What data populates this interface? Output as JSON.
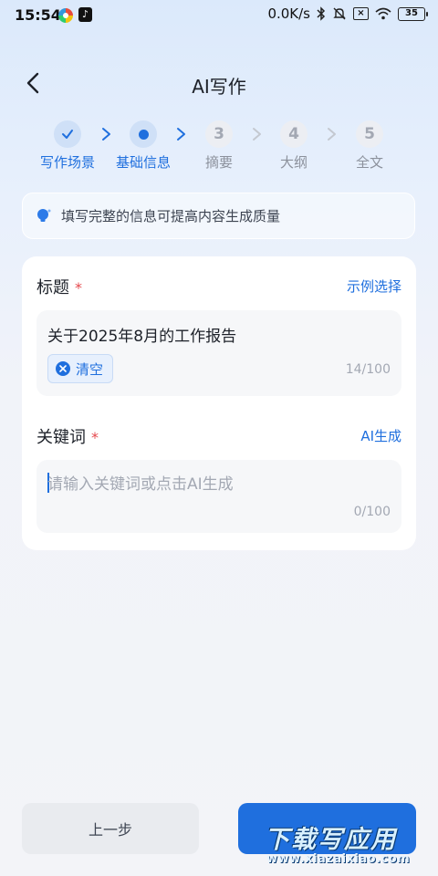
{
  "status_bar": {
    "time": "15:54",
    "net_speed": "0.0K/s",
    "battery": "35",
    "app_icon_2": "♪"
  },
  "header": {
    "title": "AI写作",
    "back_icon": "chevron-left-icon"
  },
  "steps": [
    {
      "number": "✓",
      "label": "写作场景",
      "state": "done"
    },
    {
      "number": "●",
      "label": "基础信息",
      "state": "active"
    },
    {
      "number": "3",
      "label": "摘要",
      "state": "pending"
    },
    {
      "number": "4",
      "label": "大纲",
      "state": "pending"
    },
    {
      "number": "5",
      "label": "全文",
      "state": "pending"
    }
  ],
  "tip": {
    "text": "填写完整的信息可提高内容生成质量",
    "icon": "lightbulb-icon"
  },
  "form": {
    "title_field": {
      "label": "标题",
      "required_mark": "*",
      "link": "示例选择",
      "value": "关于2025年8月的工作报告",
      "clear_label": "清空",
      "counter": "14/100"
    },
    "keywords_field": {
      "label": "关键词",
      "required_mark": "*",
      "link": "AI生成",
      "placeholder": "请输入关键词或点击AI生成",
      "counter": "0/100"
    }
  },
  "footer": {
    "prev_label": "上一步"
  },
  "watermark": {
    "title": "下载写应用",
    "url": "www.xiazaixiao.com"
  },
  "colors": {
    "accent": "#1f6fde",
    "required": "#e5484d"
  }
}
